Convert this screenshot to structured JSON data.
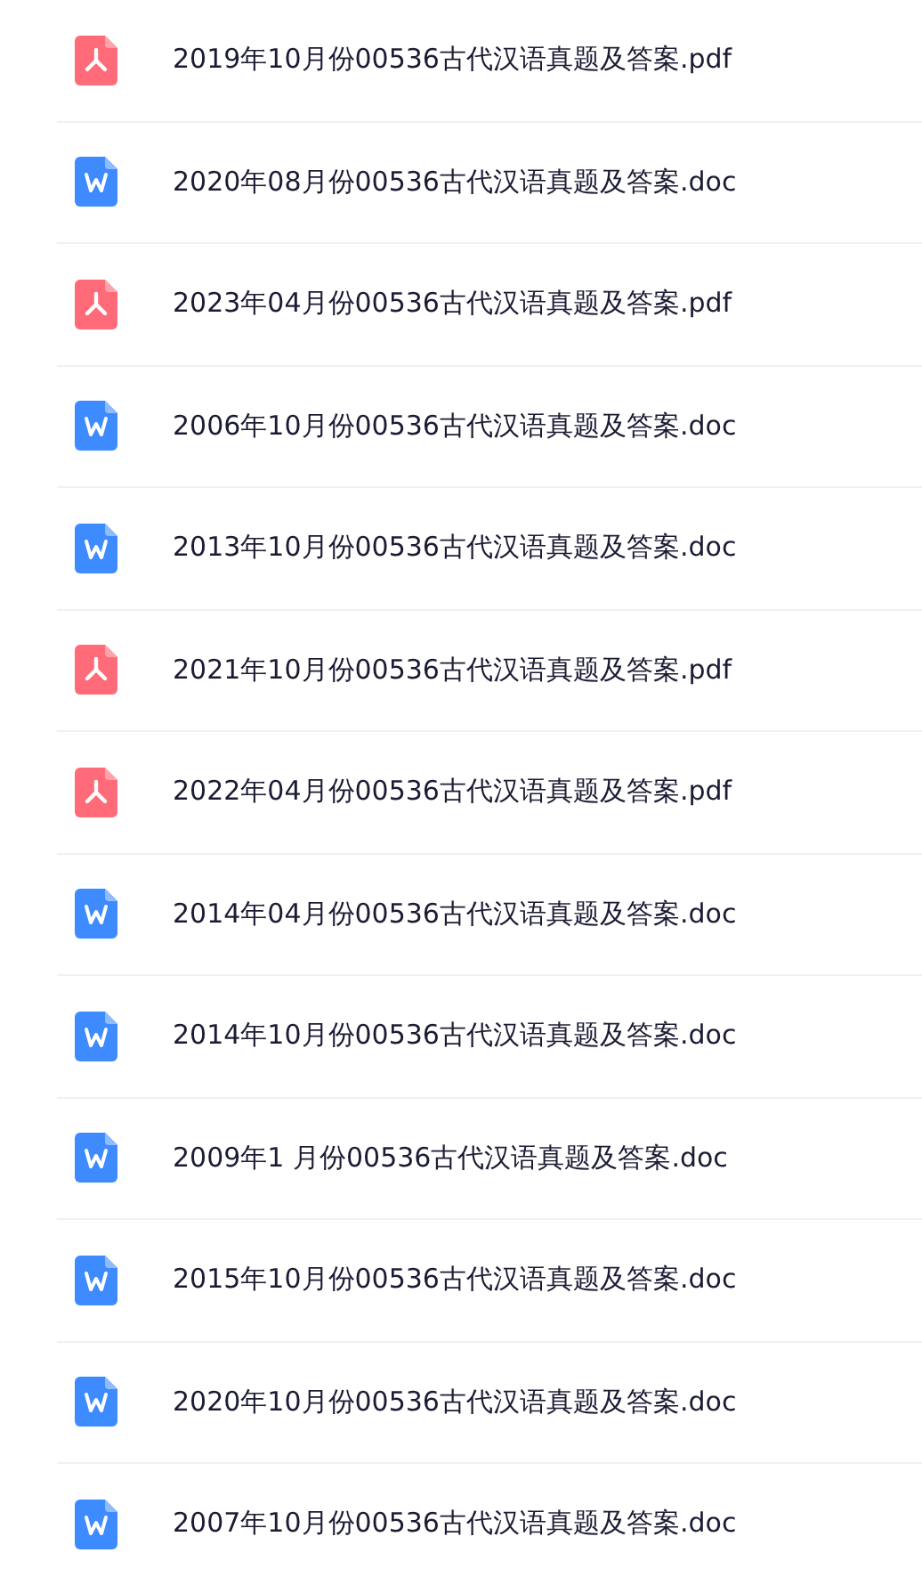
{
  "files": [
    {
      "name": "2019年10月份00536古代汉语真题及答案.pdf",
      "kind": "pdf"
    },
    {
      "name": "2020年08月份00536古代汉语真题及答案.doc",
      "kind": "doc"
    },
    {
      "name": "2023年04月份00536古代汉语真题及答案.pdf",
      "kind": "pdf"
    },
    {
      "name": "2006年10月份00536古代汉语真题及答案.doc",
      "kind": "doc"
    },
    {
      "name": "2013年10月份00536古代汉语真题及答案.doc",
      "kind": "doc"
    },
    {
      "name": "2021年10月份00536古代汉语真题及答案.pdf",
      "kind": "pdf"
    },
    {
      "name": "2022年04月份00536古代汉语真题及答案.pdf",
      "kind": "pdf"
    },
    {
      "name": "2014年04月份00536古代汉语真题及答案.doc",
      "kind": "doc"
    },
    {
      "name": "2014年10月份00536古代汉语真题及答案.doc",
      "kind": "doc"
    },
    {
      "name": "2009年1 月份00536古代汉语真题及答案.doc",
      "kind": "doc"
    },
    {
      "name": "2015年10月份00536古代汉语真题及答案.doc",
      "kind": "doc"
    },
    {
      "name": "2020年10月份00536古代汉语真题及答案.doc",
      "kind": "doc"
    },
    {
      "name": "2007年10月份00536古代汉语真题及答案.doc",
      "kind": "doc"
    }
  ]
}
